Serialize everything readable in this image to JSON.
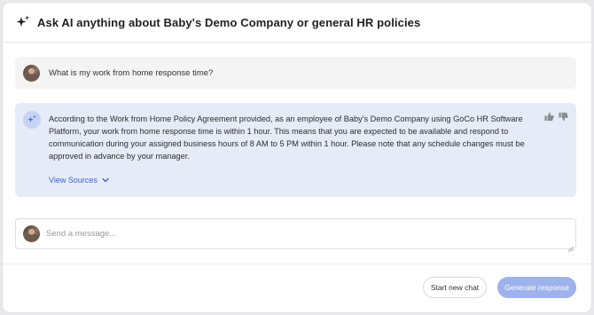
{
  "header": {
    "title": "Ask AI anything about Baby's Demo Company or general HR policies",
    "icon": "sparkle-icon"
  },
  "conversation": {
    "user_message": "What is my work from home response time?",
    "ai_message": "According to the Work from Home Policy Agreement provided, as an employee of Baby's Demo Company using GoCo HR Software Platform, your work from home response time is within 1 hour. This means that you are expected to be available and respond to communication during your assigned business hours of 8 AM to 5 PM within 1 hour. Please note that any schedule changes must be approved in advance by your manager.",
    "view_sources_label": "View Sources"
  },
  "composer": {
    "placeholder": "Send a message..."
  },
  "actions": {
    "new_chat_label": "Start new chat",
    "generate_label": "Generate response"
  },
  "colors": {
    "ai_bubble": "#e6ebf8",
    "user_bubble": "#f4f4f5",
    "accent": "#3c63c9",
    "generate_button": "#9fb2ec"
  }
}
